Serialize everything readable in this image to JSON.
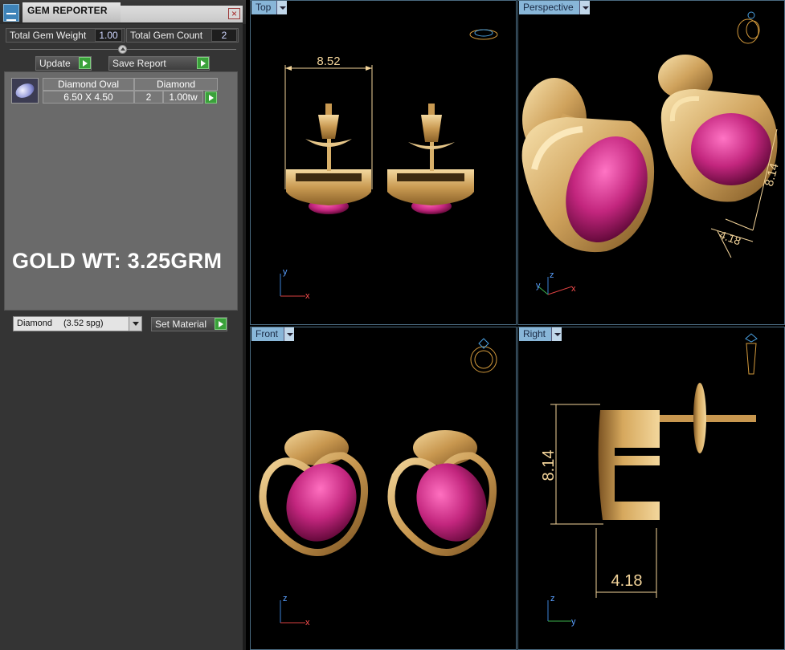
{
  "panel": {
    "title": "GEM REPORTER",
    "close_glyph": "×",
    "total_gem_weight_label": "Total Gem Weight",
    "total_gem_weight_value": "1.00",
    "total_gem_count_label": "Total Gem Count",
    "total_gem_count_value": "2",
    "update_label": "Update",
    "save_report_label": "Save Report",
    "gem_row": {
      "header_name": "Diamond Oval",
      "header_material": "Diamond",
      "size": "6.50 X 4.50",
      "count": "2",
      "weight": "1.00tw"
    },
    "gold_weight": "GOLD WT: 3.25GRM",
    "material_select": {
      "name": "Diamond",
      "spg": "(3.52 spg)"
    },
    "set_material_label": "Set Material"
  },
  "viewports": {
    "top": {
      "label": "Top",
      "dimension": "8.52",
      "axis_a": "y",
      "axis_b": "x"
    },
    "perspective": {
      "label": "Perspective",
      "dimension_height": "8.14",
      "dimension_width": "4.18",
      "axis_a": "z",
      "axis_b": "y",
      "axis_c": "x"
    },
    "front": {
      "label": "Front",
      "axis_a": "z",
      "axis_b": "x"
    },
    "right": {
      "label": "Right",
      "dimension_height": "8.14",
      "dimension_width": "4.18",
      "axis_a": "z",
      "axis_b": "y"
    }
  },
  "colors": {
    "gold": "#d8b06a",
    "gem": "#c3267e",
    "dimension": "#f3d49a",
    "tab": "#88b6d8",
    "accent_green": "#3aa13a"
  },
  "icons": [
    "app-icon",
    "close-icon",
    "gem-oval-icon",
    "play-icon",
    "dropdown-arrow-icon",
    "ring-icon",
    "axis-gizmo-icon"
  ]
}
